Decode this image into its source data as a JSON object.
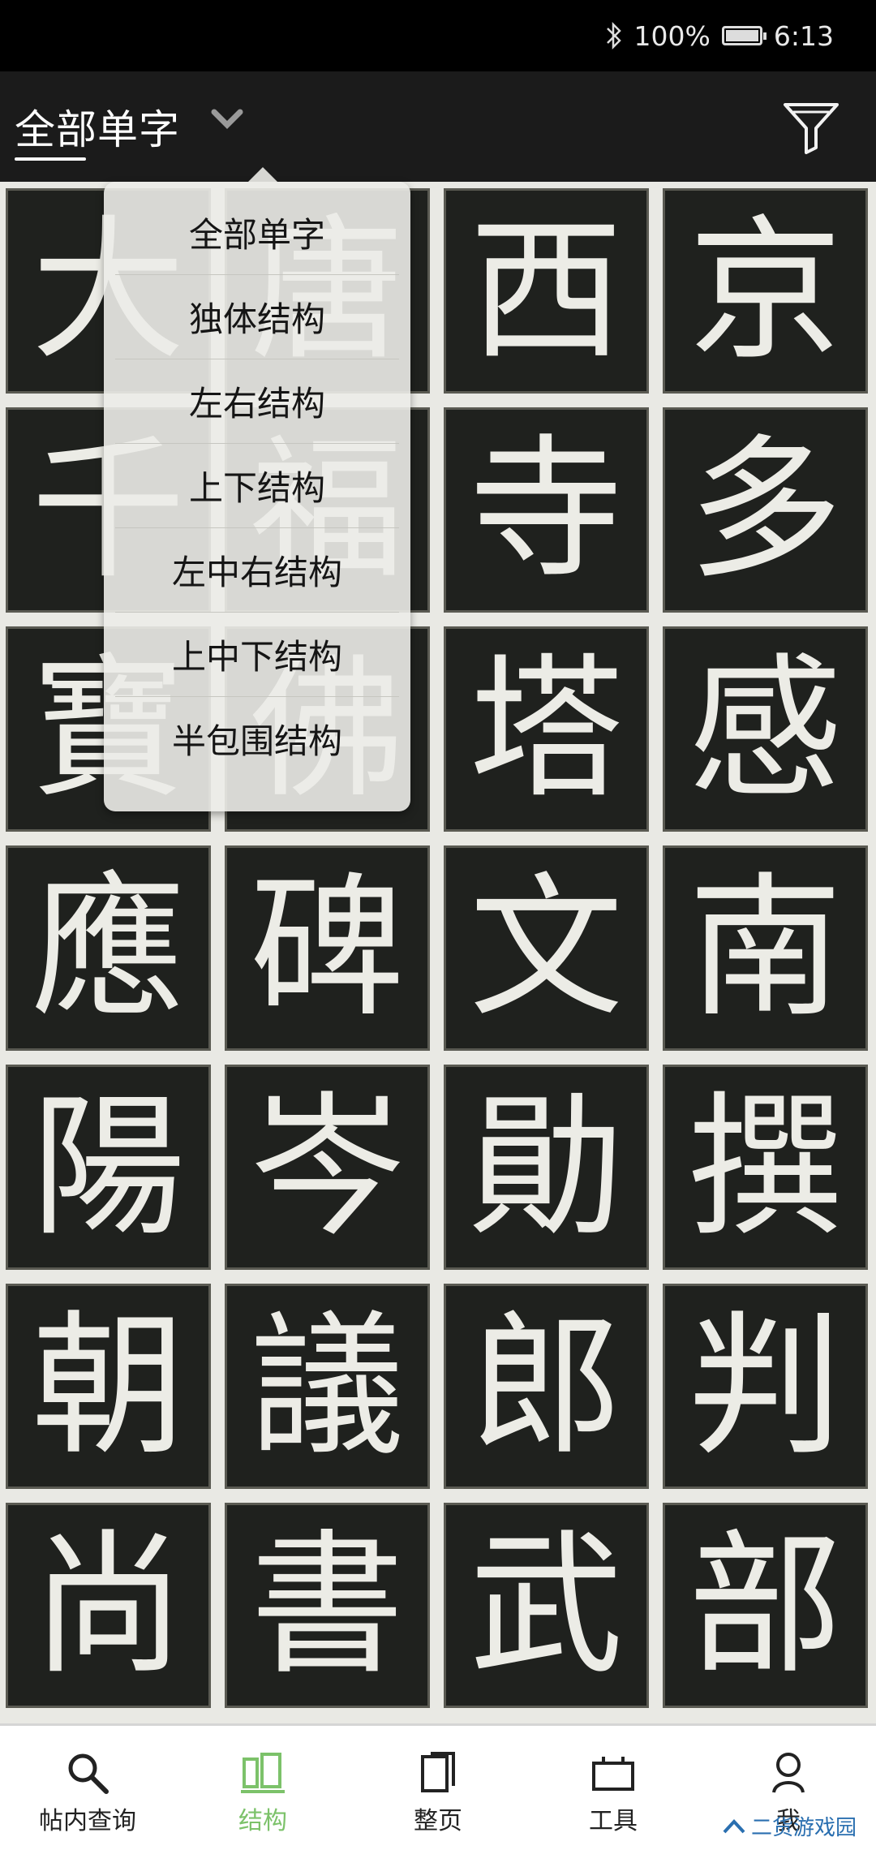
{
  "status": {
    "battery_text": "100%",
    "battery_fraction": 1.0,
    "time": "6:13"
  },
  "header": {
    "title": "全部单字"
  },
  "dropdown": {
    "items": [
      "全部单字",
      "独体结构",
      "左右结构",
      "上下结构",
      "左中右结构",
      "上中下结构",
      "半包围结构"
    ]
  },
  "grid": {
    "chars": [
      "大",
      "唐",
      "西",
      "京",
      "千",
      "福",
      "寺",
      "多",
      "寶",
      "佛",
      "塔",
      "感",
      "應",
      "碑",
      "文",
      "南",
      "陽",
      "岑",
      "勛",
      "撰",
      "朝",
      "議",
      "郎",
      "判",
      "尚",
      "書",
      "武",
      "部"
    ]
  },
  "nav": {
    "items": [
      {
        "label": "帖内查询",
        "icon": "search-icon"
      },
      {
        "label": "结构",
        "icon": "structure-icon"
      },
      {
        "label": "整页",
        "icon": "page-icon"
      },
      {
        "label": "工具",
        "icon": "toolbox-icon"
      },
      {
        "label": "我",
        "icon": "me-icon"
      }
    ],
    "active_color": "#7cc26a"
  },
  "watermark": {
    "text": "二货游戏园"
  }
}
